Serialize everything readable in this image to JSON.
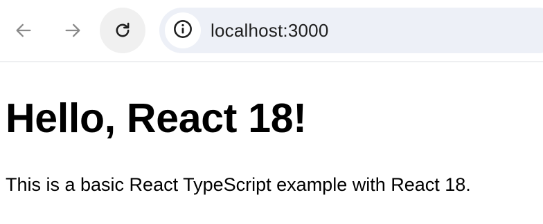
{
  "browser": {
    "back_icon": "arrow-left-icon",
    "forward_icon": "arrow-right-icon",
    "reload_icon": "reload-icon",
    "site_info_icon": "info-icon",
    "url": "localhost:3000",
    "colors": {
      "omnibox_bg": "#edf0f7",
      "reload_hover_bg": "#f0f0f0",
      "icon_gray": "#8a8a8a",
      "icon_dark": "#1f1f1f"
    }
  },
  "page": {
    "title": "Hello, React 18!",
    "description": "This is a basic React TypeScript example with React 18."
  }
}
